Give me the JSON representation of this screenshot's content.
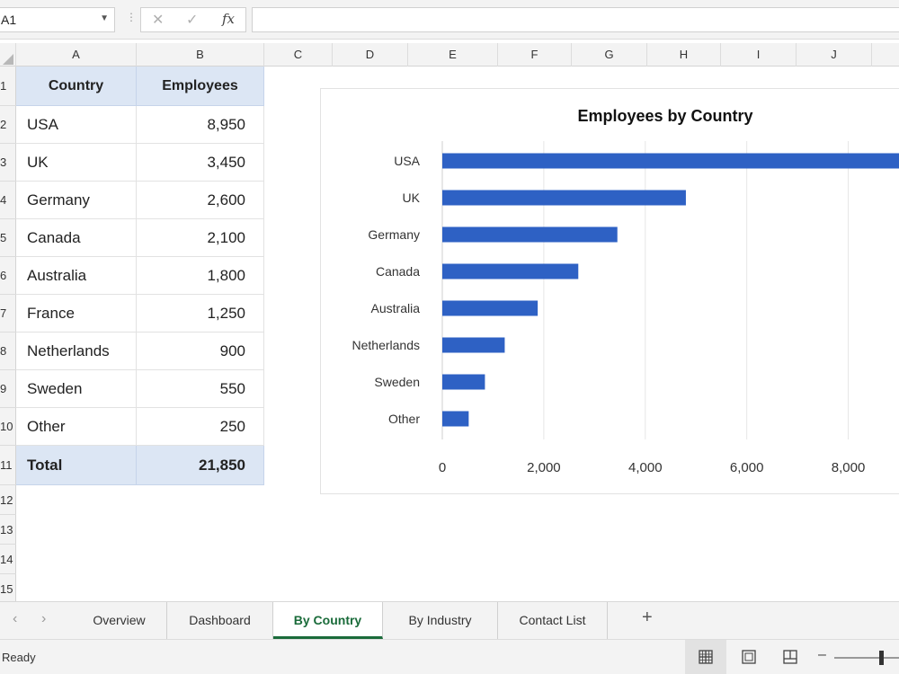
{
  "formula_bar": {
    "cell_ref": "A1",
    "cancel_glyph": "✕",
    "enter_glyph": "✓",
    "fx_label": "fx",
    "formula_value": ""
  },
  "columns": [
    "A",
    "B",
    "C",
    "D",
    "E",
    "F",
    "G",
    "H",
    "I",
    "J"
  ],
  "rows": [
    "1",
    "2",
    "3",
    "4",
    "5",
    "6",
    "7",
    "8",
    "9",
    "10",
    "11",
    "12",
    "13",
    "14",
    "15"
  ],
  "table": {
    "headers": [
      "Country",
      "Employees"
    ],
    "rows": [
      [
        "USA",
        "8,950"
      ],
      [
        "UK",
        "3,450"
      ],
      [
        "Germany",
        "2,600"
      ],
      [
        "Canada",
        "2,100"
      ],
      [
        "Australia",
        "1,800"
      ],
      [
        "France",
        "1,250"
      ],
      [
        "Netherlands",
        "900"
      ],
      [
        "Sweden",
        "550"
      ],
      [
        "Other",
        "250"
      ]
    ],
    "total": [
      "Total",
      "21,850"
    ]
  },
  "chart_data": {
    "type": "bar",
    "orientation": "horizontal",
    "title": "Employees by Country",
    "categories": [
      "USA",
      "UK",
      "Germany",
      "Canada",
      "Australia",
      "Netherlands",
      "Sweden",
      "Other"
    ],
    "values": [
      9050,
      4800,
      3450,
      2680,
      1880,
      1230,
      840,
      520
    ],
    "xlim": [
      0,
      9000
    ],
    "x_ticks": [
      "0",
      "2,000",
      "4,000",
      "6,000",
      "8,000"
    ],
    "grid": true,
    "bar_color": "#2e61c4"
  },
  "sheet_tabs": [
    "Overview",
    "Dashboard",
    "By Country",
    "By Industry",
    "Contact List"
  ],
  "active_tab": "By Country",
  "nav": {
    "prev": "‹",
    "next": "›",
    "add": "+"
  },
  "status": {
    "text": "Ready",
    "zoom_minus": "–"
  },
  "colors": {
    "accent": "#1a6b3a",
    "header_fill": "#dce6f4"
  }
}
